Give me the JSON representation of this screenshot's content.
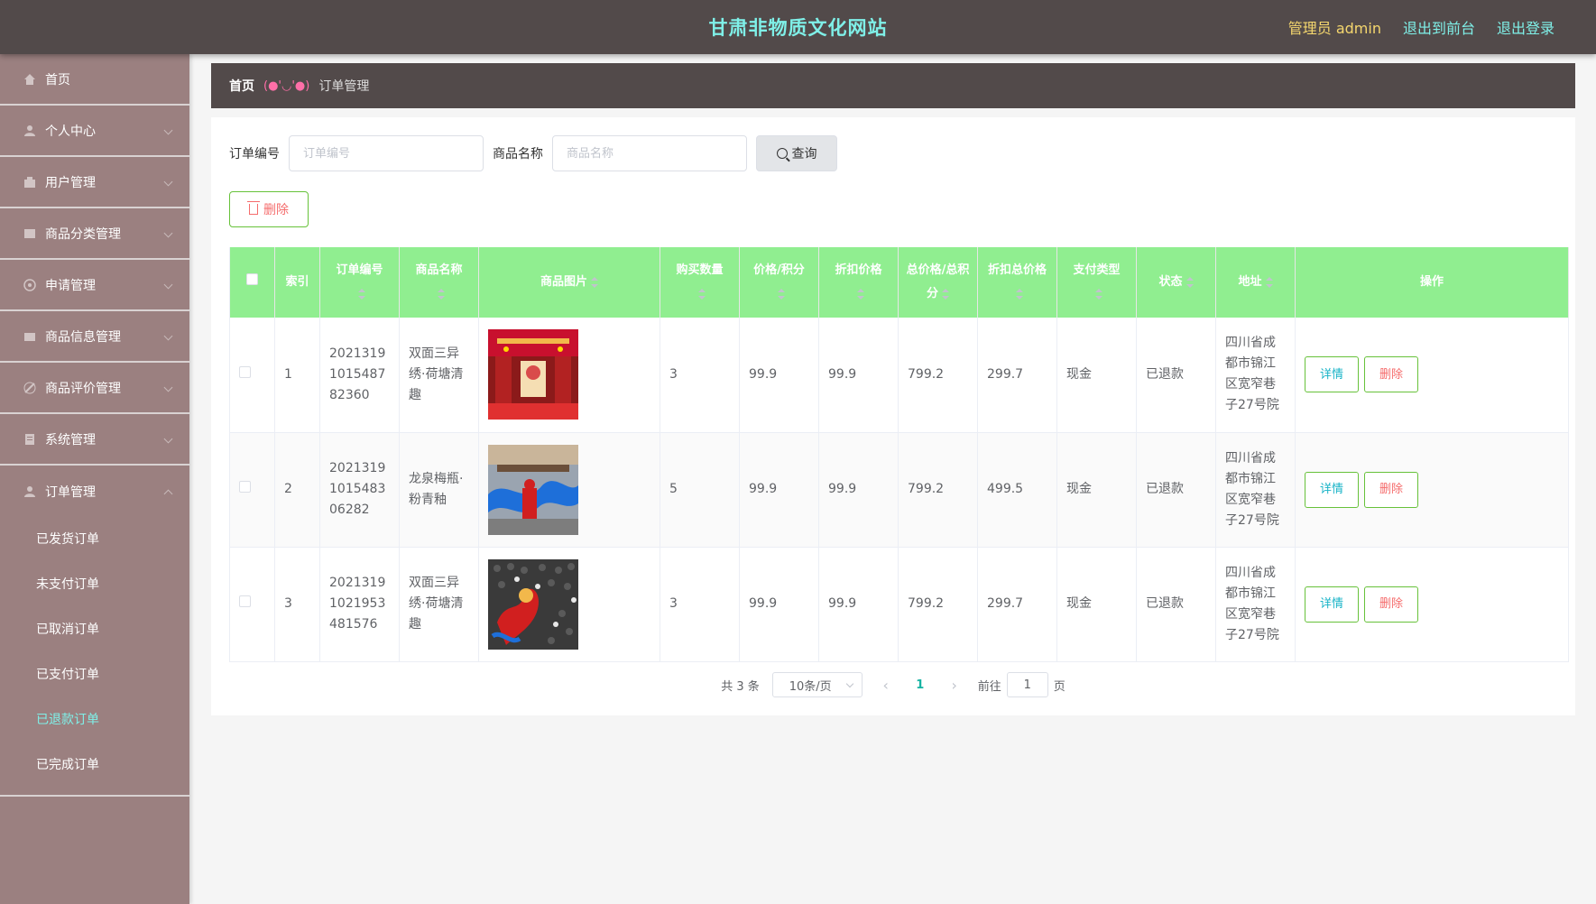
{
  "header": {
    "title": "甘肃非物质文化网站",
    "admin_label": "管理员 admin",
    "front_link": "退出到前台",
    "logout_link": "退出登录"
  },
  "sidebar": {
    "items": [
      {
        "label": "首页",
        "icon": "home-icon"
      },
      {
        "label": "个人中心",
        "icon": "user-icon"
      },
      {
        "label": "用户管理",
        "icon": "users-icon"
      },
      {
        "label": "商品分类管理",
        "icon": "category-icon"
      },
      {
        "label": "申请管理",
        "icon": "apply-icon"
      },
      {
        "label": "商品信息管理",
        "icon": "goods-icon"
      },
      {
        "label": "商品评价管理",
        "icon": "review-icon"
      },
      {
        "label": "系统管理",
        "icon": "system-icon"
      },
      {
        "label": "订单管理",
        "icon": "order-icon"
      }
    ],
    "submenu": [
      "已发货订单",
      "未支付订单",
      "已取消订单",
      "已支付订单",
      "已退款订单",
      "已完成订单"
    ],
    "active_sub": "已退款订单"
  },
  "breadcrumb": {
    "home": "首页",
    "separator": "(●'◡'●)",
    "current": "订单管理"
  },
  "search": {
    "order_label": "订单编号",
    "order_placeholder": "订单编号",
    "goods_label": "商品名称",
    "goods_placeholder": "商品名称",
    "button": "查询"
  },
  "toolbar": {
    "delete_label": "删除"
  },
  "table": {
    "headers": [
      "索引",
      "订单编号",
      "商品名称",
      "商品图片",
      "购买数量",
      "价格/积分",
      "折扣价格",
      "总价格/总积分",
      "折扣总价格",
      "支付类型",
      "状态",
      "地址",
      "操作"
    ],
    "detail_label": "详情",
    "delete_label": "删除",
    "rows": [
      {
        "index": "1",
        "order_no": "2021319101548782360",
        "goods": "双面三异绣·荷塘清趣",
        "qty": "3",
        "price": "99.9",
        "discount_price": "99.9",
        "total": "799.2",
        "discount_total": "299.7",
        "pay_type": "现金",
        "status": "已退款",
        "address": "四川省成都市锦江区宽窄巷子27号院",
        "image": "temple-hall-red"
      },
      {
        "index": "2",
        "order_no": "2021319101548306282",
        "goods": "龙泉梅瓶·粉青釉",
        "qty": "5",
        "price": "99.9",
        "discount_price": "99.9",
        "total": "799.2",
        "discount_total": "499.5",
        "pay_type": "现金",
        "status": "已退款",
        "address": "四川省成都市锦江区宽窄巷子27号院",
        "image": "dragon-dance-street"
      },
      {
        "index": "3",
        "order_no": "20213191021953481576",
        "goods": "双面三异绣·荷塘清趣",
        "qty": "3",
        "price": "99.9",
        "discount_price": "99.9",
        "total": "799.2",
        "discount_total": "299.7",
        "pay_type": "现金",
        "status": "已退款",
        "address": "四川省成都市锦江区宽窄巷子27号院",
        "image": "dragon-dance-crowd"
      }
    ]
  },
  "pagination": {
    "total": "共 3 条",
    "page_size": "10条/页",
    "current_page": "1",
    "goto_label": "前往",
    "goto_value": "1",
    "page_suffix": "页"
  },
  "colors": {
    "header_bg": "#524a4a",
    "sidebar_bg": "#9b8080",
    "table_header_bg": "#90ee90",
    "accent": "#7ff0e8"
  }
}
